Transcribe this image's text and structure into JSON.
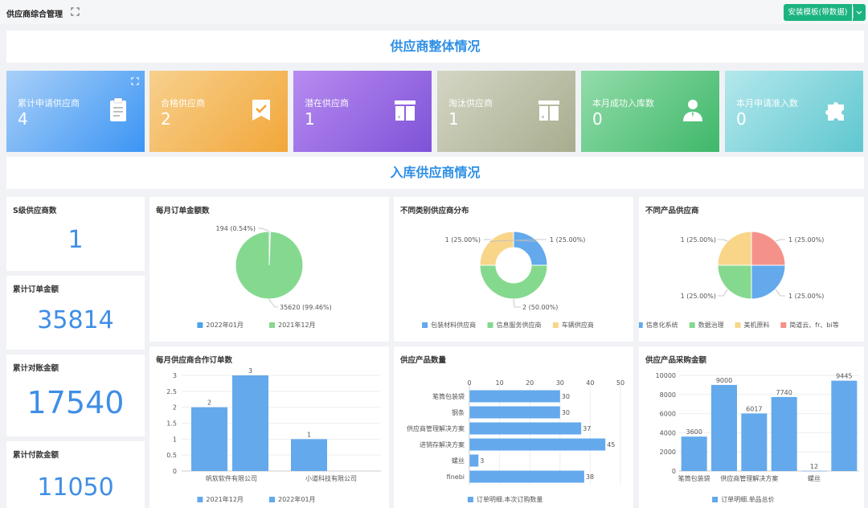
{
  "app": {
    "title": "供应商综合管理",
    "install_button": "安装模板(带数据)"
  },
  "section1": {
    "title": "供应商整体情况"
  },
  "section2": {
    "title": "入库供应商情况"
  },
  "stats": [
    {
      "label": "累计申请供应商",
      "value": "4",
      "icon": "clipboard-icon",
      "from": "#a9cff8",
      "to": "#3b95f4"
    },
    {
      "label": "合格供应商",
      "value": "2",
      "icon": "check-badge-icon",
      "from": "#f7d08d",
      "to": "#f2a73a"
    },
    {
      "label": "潜在供应商",
      "value": "1",
      "icon": "building-icon",
      "from": "#b78bf0",
      "to": "#7f52d8"
    },
    {
      "label": "淘汰供应商",
      "value": "1",
      "icon": "building-icon",
      "from": "#d4d6c4",
      "to": "#a8ad8f"
    },
    {
      "label": "本月成功入库数",
      "value": "0",
      "icon": "user-icon",
      "from": "#93dcaa",
      "to": "#3fb86a"
    },
    {
      "label": "本月申请准入数",
      "value": "0",
      "icon": "puzzle-icon",
      "from": "#b3e8ec",
      "to": "#5fc7cf"
    }
  ],
  "kpis": [
    {
      "title": "S级供应商数",
      "value": "1"
    },
    {
      "title": "累计订单金额",
      "value": "35814"
    },
    {
      "title": "累计对账金额",
      "value": "17540"
    },
    {
      "title": "累计付款金额",
      "value": "11050"
    }
  ],
  "charts": {
    "monthly_amount": {
      "title": "每月订单金额数"
    },
    "category_dist": {
      "title": "不同类别供应商分布"
    },
    "product_supplier": {
      "title": "不同产品供应商"
    },
    "monthly_orders": {
      "title": "每月供应商合作订单数"
    },
    "product_qty": {
      "title": "供应产品数量"
    },
    "purchase_amount": {
      "title": "供应产品采购金额"
    }
  },
  "chart_data": [
    {
      "id": "monthly_amount",
      "type": "pie",
      "labels": [
        "2022年01月",
        "2021年12月"
      ],
      "values": [
        194,
        35620
      ],
      "data_labels": [
        "194 (0.54%)",
        "35620 (99.46%)"
      ],
      "colors": [
        "#4ea3e8",
        "#85d98f"
      ],
      "legend": "bottom"
    },
    {
      "id": "category_dist",
      "type": "pie",
      "donut": true,
      "labels": [
        "包装材料供应商",
        "信息服务供应商",
        "车辆供应商"
      ],
      "values": [
        1,
        2,
        1
      ],
      "data_labels": [
        "1 (25.00%)",
        "2 (50.00%)",
        "1 (25.00%)"
      ],
      "colors": [
        "#63a9ec",
        "#85d98f",
        "#f9d58a"
      ],
      "legend": "bottom"
    },
    {
      "id": "product_supplier",
      "type": "pie",
      "labels": [
        "信息化系统",
        "数据治理",
        "美机原料",
        "简道云、fr、bi等"
      ],
      "values": [
        1,
        1,
        1,
        1
      ],
      "data_labels": [
        "1 (25.00%)",
        "1 (25.00%)",
        "1 (25.00%)",
        "1 (25.00%)"
      ],
      "colors": [
        "#63a9ec",
        "#85d98f",
        "#f9d58a",
        "#f4928a"
      ],
      "legend": "bottom"
    },
    {
      "id": "monthly_orders",
      "type": "bar",
      "categories": [
        "帆软软件有限公司",
        "小道科技有限公司"
      ],
      "series": [
        {
          "name": "2021年12月",
          "values": [
            2,
            1
          ]
        },
        {
          "name": "2022年01月",
          "values": [
            3,
            null
          ]
        }
      ],
      "y_ticks": [
        "0",
        "0.5",
        "1",
        "1.5",
        "2",
        "2.5",
        "3"
      ],
      "ylim": [
        0,
        3
      ],
      "color": "#63a9ec",
      "legend": "bottom"
    },
    {
      "id": "product_qty",
      "type": "bar",
      "orientation": "horizontal",
      "categories": [
        "笔筒包装袋",
        "钢条",
        "供应商管理解决方案",
        "进销存解决方案",
        "螺丝",
        "finebi"
      ],
      "series": [
        {
          "name": "订单明细.本次订购数量",
          "values": [
            30,
            30,
            37,
            45,
            3,
            38
          ]
        }
      ],
      "x_ticks": [
        "0",
        "10",
        "20",
        "30",
        "40",
        "50"
      ],
      "xlim": [
        0,
        50
      ],
      "color": "#63a9ec",
      "legend": "bottom"
    },
    {
      "id": "purchase_amount",
      "type": "bar",
      "x_tick_labels": [
        "笔筒包装袋",
        "供应商管理解决方案",
        "螺丝"
      ],
      "series": [
        {
          "name": "订单明细.单品总价",
          "values": [
            3600,
            9000,
            6017,
            7740,
            12,
            9445
          ]
        }
      ],
      "y_ticks": [
        "0",
        "2000",
        "4000",
        "6000",
        "8000",
        "10000"
      ],
      "ylim": [
        0,
        10000
      ],
      "color": "#63a9ec",
      "legend": "bottom"
    }
  ]
}
